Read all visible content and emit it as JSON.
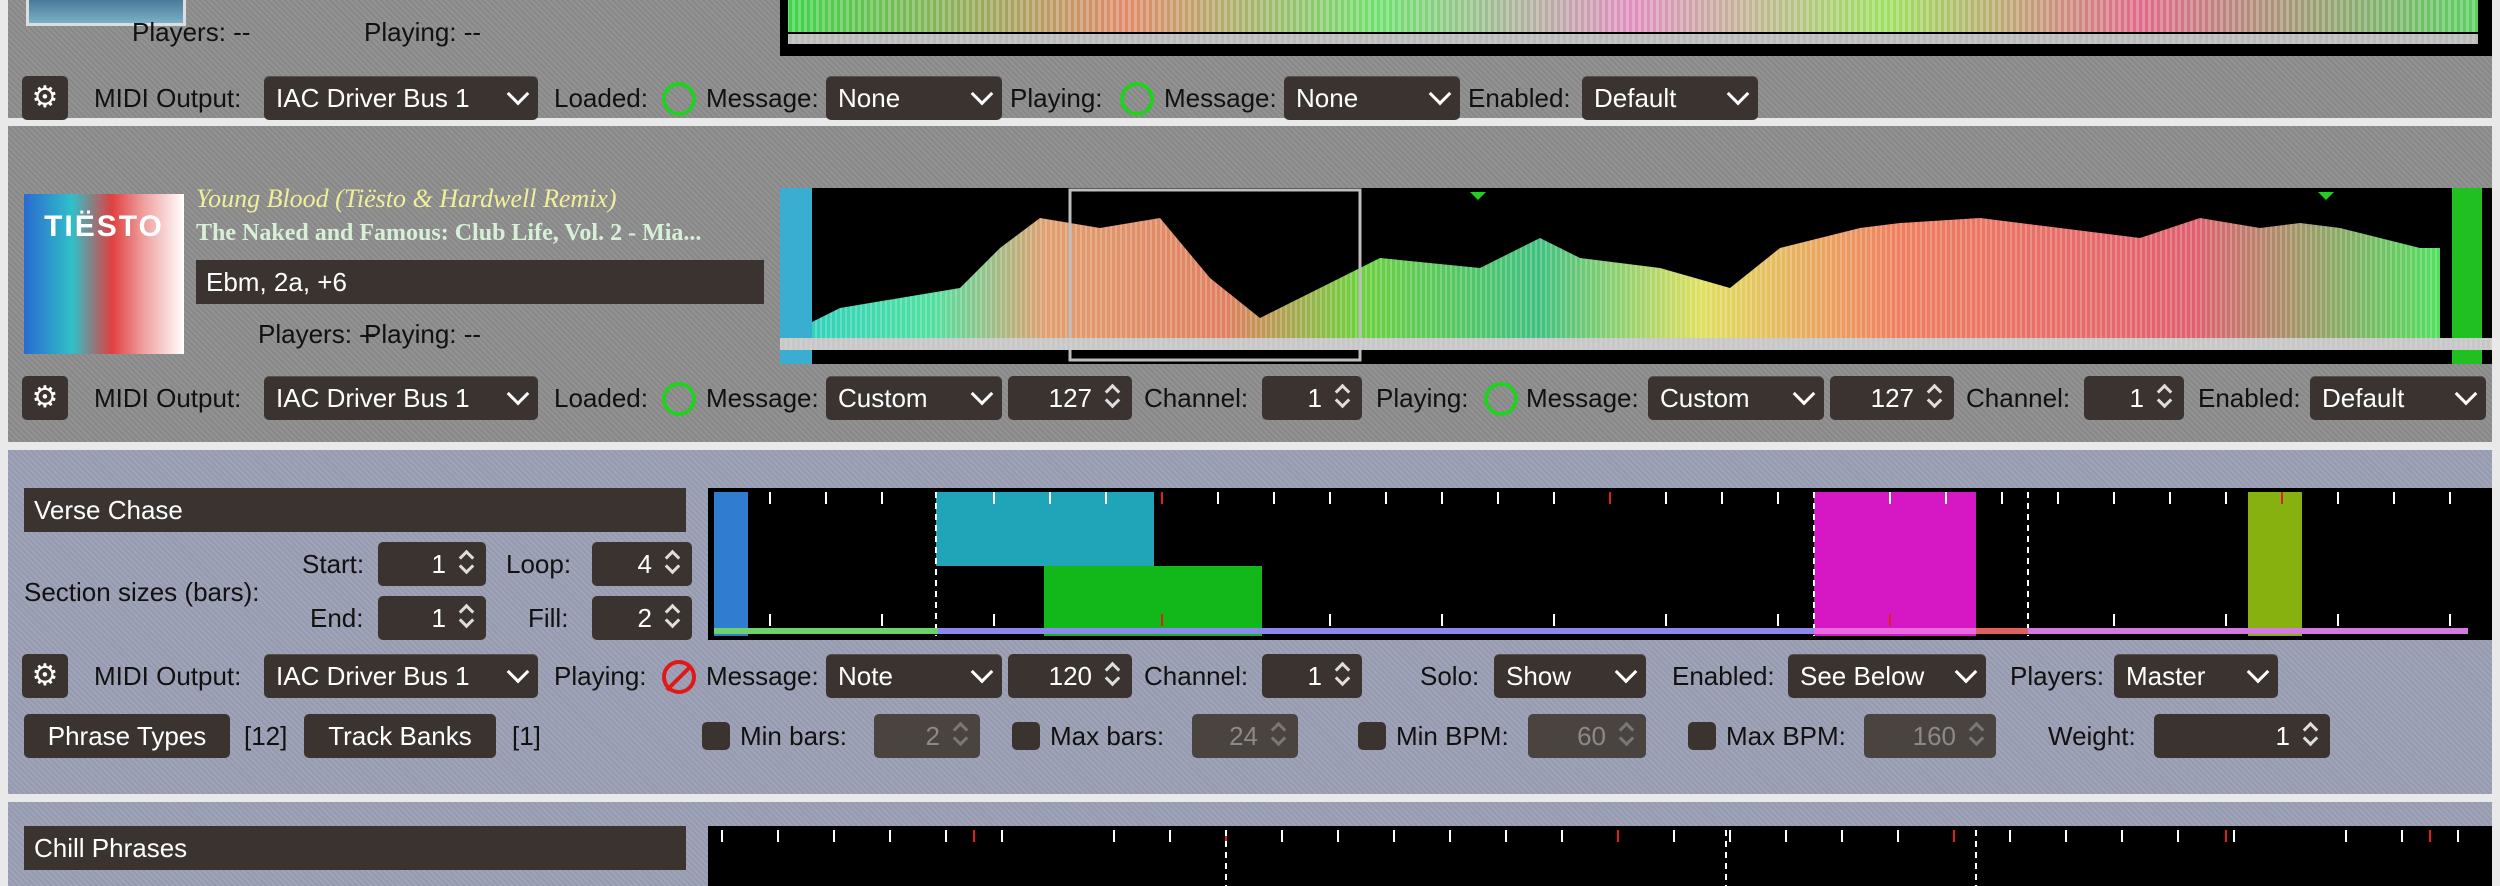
{
  "track1": {
    "players_label": "Players: --",
    "playing_label": "Playing: --",
    "midi_output_label": "MIDI Output:",
    "midi_output": "IAC Driver Bus 1",
    "loaded_label": "Loaded:",
    "message_label": "Message:",
    "loaded_message": "None",
    "playing_label2": "Playing:",
    "playing_message": "None",
    "enabled_label": "Enabled:",
    "enabled": "Default"
  },
  "track2": {
    "title": "Young Blood (Tiësto & Hardwell Remix)",
    "artist": "The Naked and Famous: Club Life, Vol. 2 - Mia...",
    "key": "Ebm, 2a, +6",
    "art_text": "TIËSTO",
    "players_label": "Players: --",
    "playing_label": "Playing: --",
    "midi_output_label": "MIDI Output:",
    "midi_output": "IAC Driver Bus 1",
    "loaded_label": "Loaded:",
    "message_label": "Message:",
    "loaded_message": "Custom",
    "loaded_note": "127",
    "channel_label": "Channel:",
    "loaded_channel": "1",
    "playing_label2": "Playing:",
    "playing_message": "Custom",
    "playing_note": "127",
    "playing_channel": "1",
    "enabled_label": "Enabled:",
    "enabled": "Default"
  },
  "phrase1": {
    "name": "Verse Chase",
    "section_sizes_label": "Section sizes (bars):",
    "start_label": "Start:",
    "start": "1",
    "loop_label": "Loop:",
    "loop": "4",
    "end_label": "End:",
    "end": "1",
    "fill_label": "Fill:",
    "fill": "2",
    "midi_output_label": "MIDI Output:",
    "midi_output": "IAC Driver Bus 1",
    "playing_label": "Playing:",
    "message_label": "Message:",
    "message": "Note",
    "note": "120",
    "channel_label": "Channel:",
    "channel": "1",
    "solo_label": "Solo:",
    "solo": "Show",
    "enabled_label": "Enabled:",
    "enabled": "See Below",
    "players_label": "Players:",
    "players": "Master",
    "phrase_types_label": "Phrase Types",
    "phrase_types_count": "[12]",
    "track_banks_label": "Track Banks",
    "track_banks_count": "[1]",
    "min_bars_label": "Min bars:",
    "min_bars": "2",
    "max_bars_label": "Max bars:",
    "max_bars": "24",
    "min_bpm_label": "Min BPM:",
    "min_bpm": "60",
    "max_bpm_label": "Max BPM:",
    "max_bpm": "160",
    "weight_label": "Weight:",
    "weight": "1"
  },
  "phrase2": {
    "name": "Chill Phrases"
  },
  "colors": {
    "panel_gray": "#8d8d8d",
    "panel_blue": "#9b9fb4",
    "control": "#3b3330",
    "indicator_green": "#22d022",
    "indicator_red": "#e01818"
  }
}
